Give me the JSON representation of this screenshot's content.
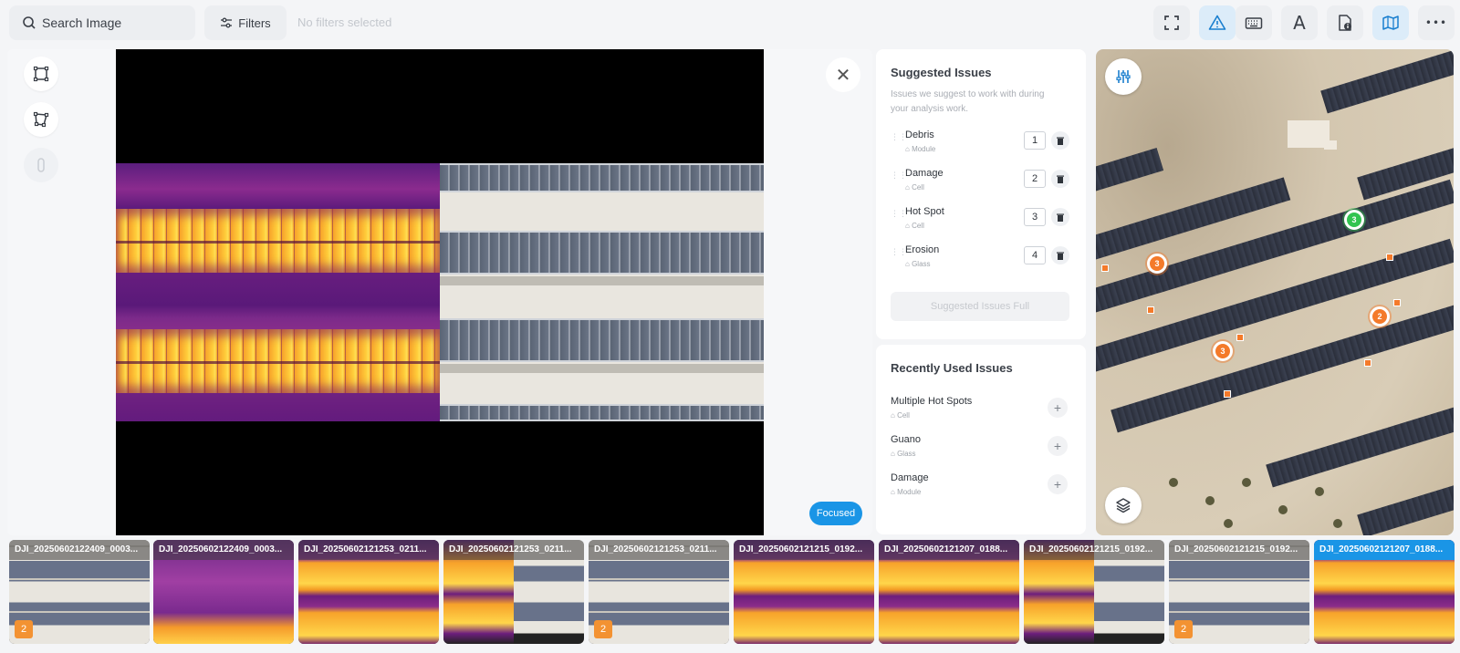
{
  "toolbar": {
    "search_placeholder": "Search Image",
    "filters_label": "Filters",
    "filters_status": "No filters selected",
    "text_tool_glyph": "A",
    "more_glyph": "•••"
  },
  "viewer": {
    "close_glyph": "✕",
    "focused_label": "Focused"
  },
  "suggested": {
    "title": "Suggested Issues",
    "description": "Issues we suggest to work with during your analysis work.",
    "items": [
      {
        "name": "Debris",
        "type": "Module",
        "key": "1"
      },
      {
        "name": "Damage",
        "type": "Cell",
        "key": "2"
      },
      {
        "name": "Hot Spot",
        "type": "Cell",
        "key": "3"
      },
      {
        "name": "Erosion",
        "type": "Glass",
        "key": "4"
      }
    ],
    "full_label": "Suggested Issues Full"
  },
  "recent": {
    "title": "Recently Used Issues",
    "items": [
      {
        "name": "Multiple Hot Spots",
        "type": "Cell"
      },
      {
        "name": "Guano",
        "type": "Glass"
      },
      {
        "name": "Damage",
        "type": "Module"
      }
    ],
    "add_glyph": "+"
  },
  "map": {
    "markers": [
      {
        "label": "3",
        "color": "orange"
      },
      {
        "label": "3",
        "color": "green"
      },
      {
        "label": "2",
        "color": "orange"
      },
      {
        "label": "3",
        "color": "orange"
      }
    ]
  },
  "thumbnails": [
    {
      "label": "DJI_20250602122409_0003...",
      "kind": "visual",
      "badge": "2"
    },
    {
      "label": "DJI_20250602122409_0003...",
      "kind": "purple",
      "badge": ""
    },
    {
      "label": "DJI_20250602121253_0211...",
      "kind": "thermal",
      "badge": ""
    },
    {
      "label": "DJI_20250602121253_0211...",
      "kind": "split",
      "badge": ""
    },
    {
      "label": "DJI_20250602121253_0211...",
      "kind": "visual",
      "badge": "2"
    },
    {
      "label": "DJI_20250602121215_0192...",
      "kind": "thermal",
      "badge": ""
    },
    {
      "label": "DJI_20250602121207_0188...",
      "kind": "thermal",
      "badge": ""
    },
    {
      "label": "DJI_20250602121215_0192...",
      "kind": "split",
      "badge": ""
    },
    {
      "label": "DJI_20250602121215_0192...",
      "kind": "visual",
      "badge": "2"
    },
    {
      "label": "DJI_20250602121207_0188...",
      "kind": "thermal",
      "badge": "",
      "selected": true
    }
  ],
  "colors": {
    "accent": "#1a95e6",
    "badge": "#f39232",
    "marker_orange": "#f47a2a",
    "marker_green": "#32c450"
  }
}
